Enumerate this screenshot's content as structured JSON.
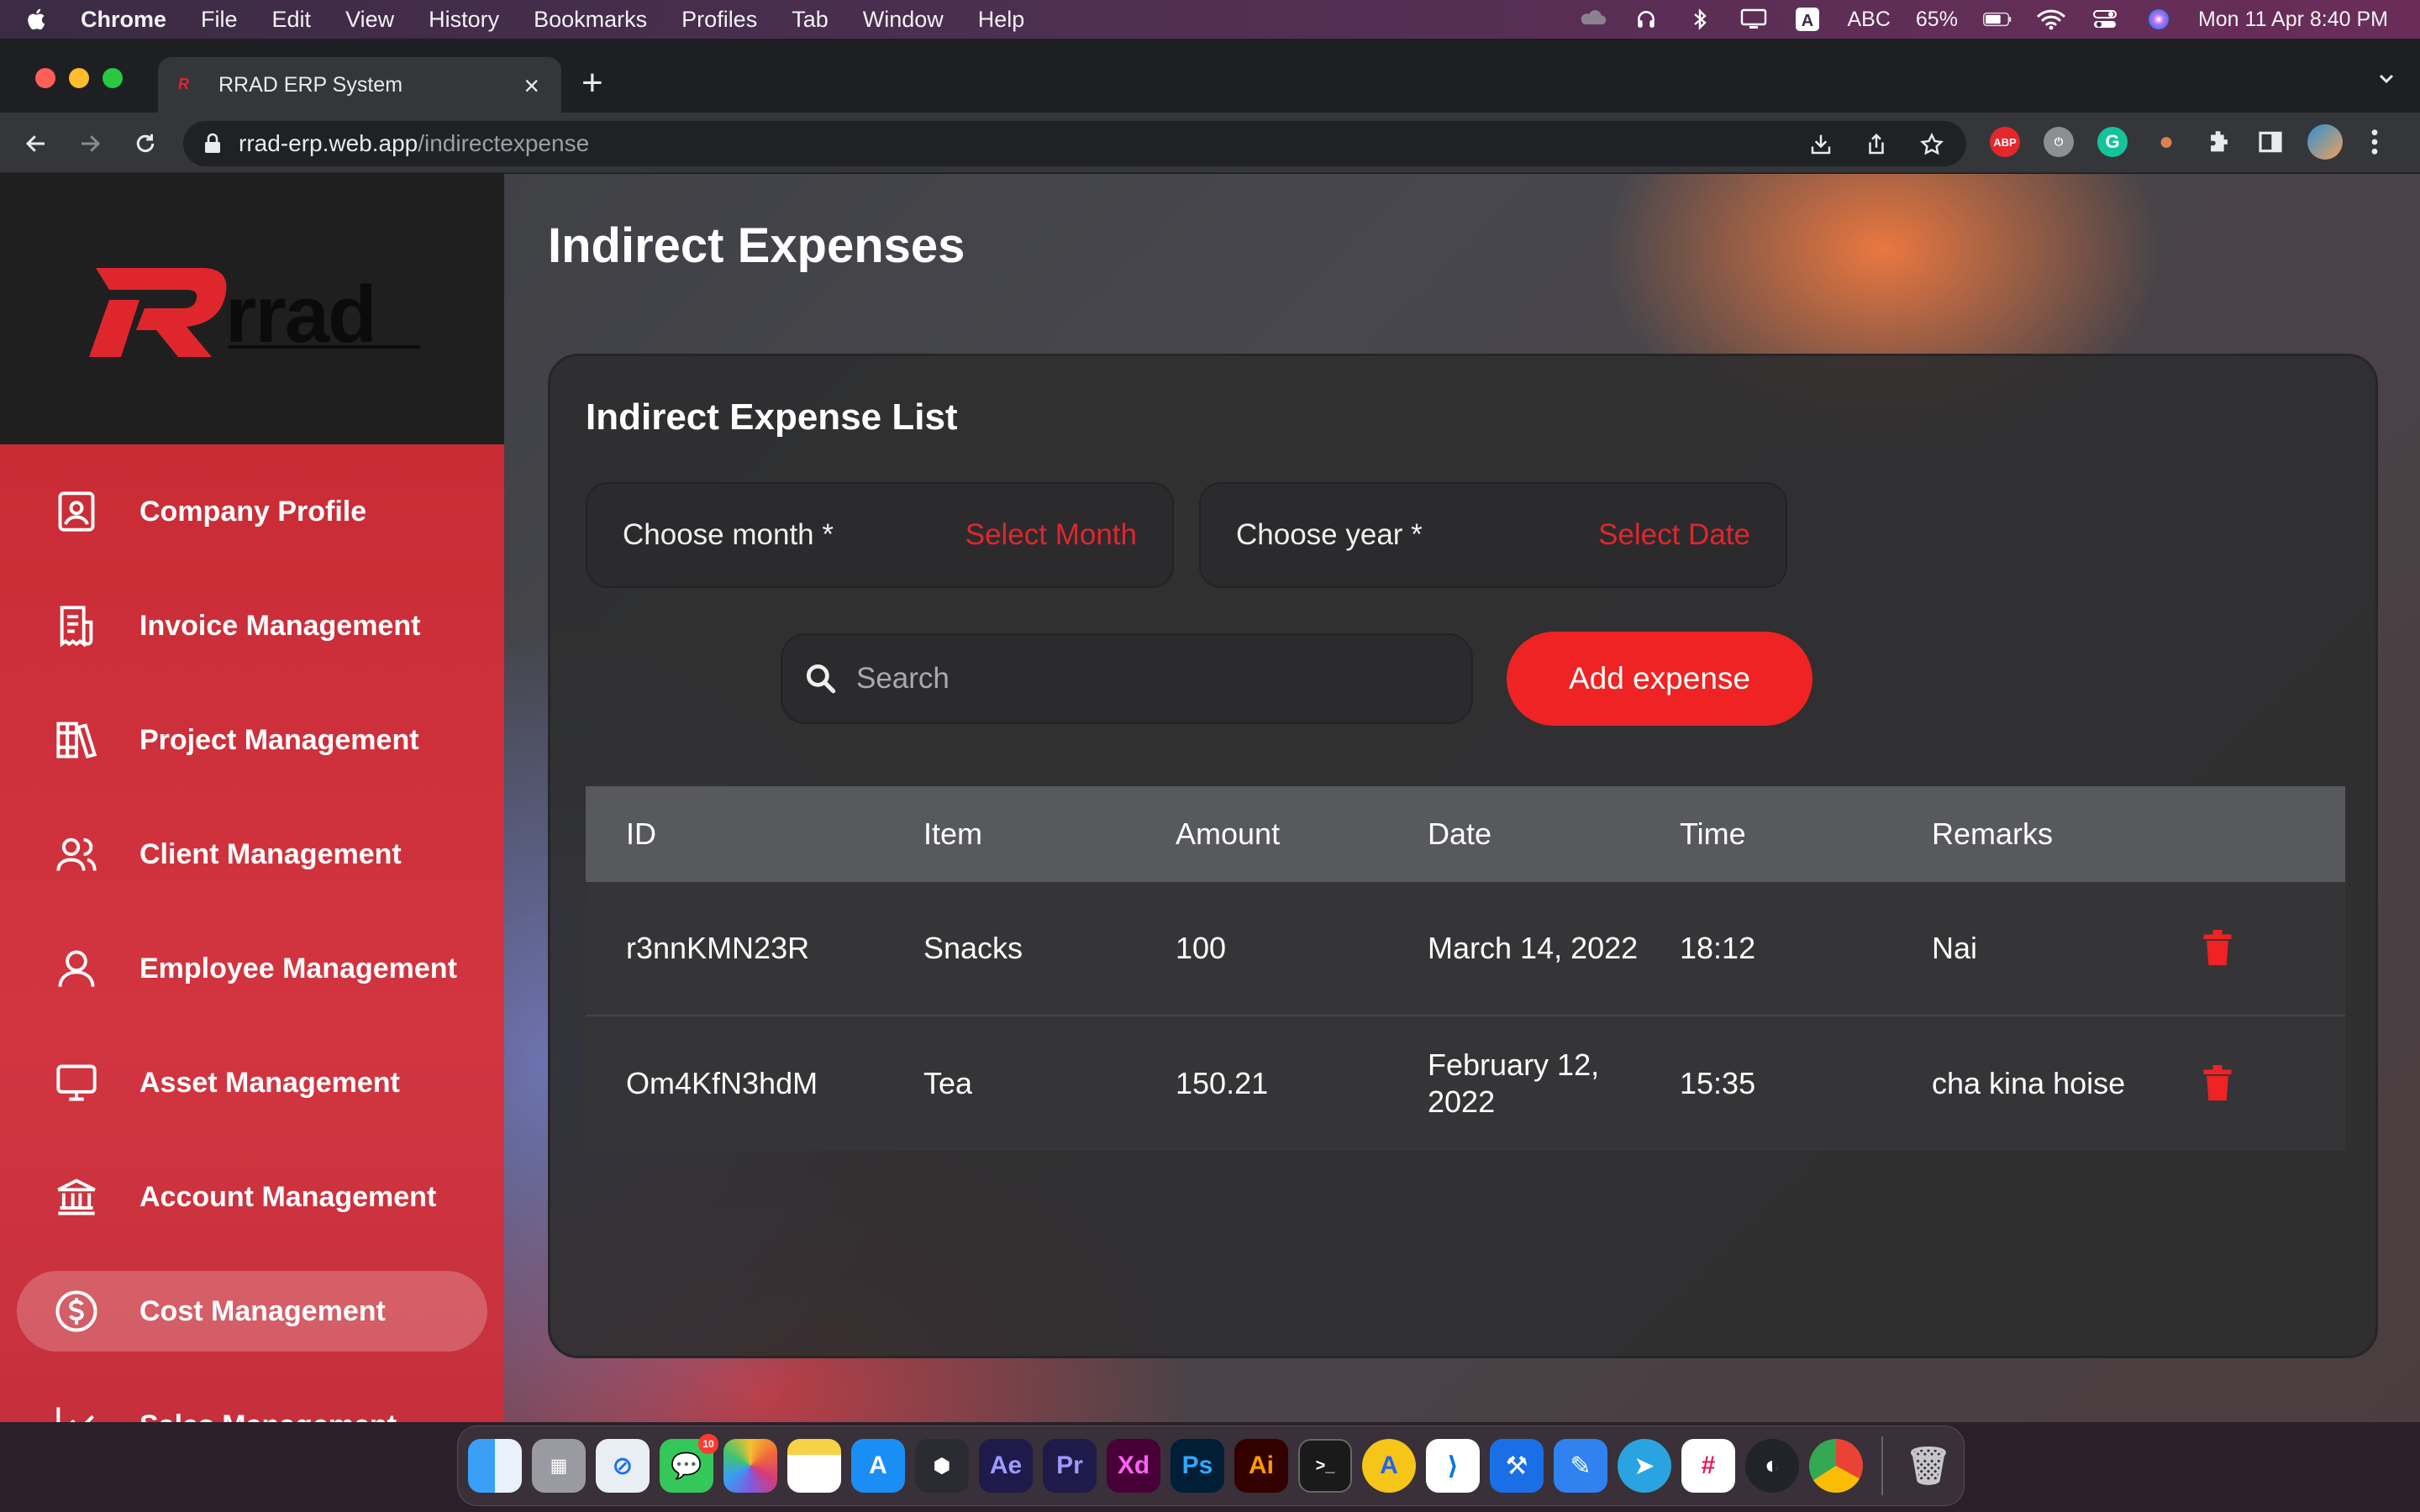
{
  "menubar": {
    "app_name": "Chrome",
    "items": [
      "File",
      "Edit",
      "View",
      "History",
      "Bookmarks",
      "Profiles",
      "Tab",
      "Window",
      "Help"
    ],
    "input_source": "ABC",
    "battery": "65%",
    "datetime": "Mon 11 Apr  8:40 PM"
  },
  "browser": {
    "tab_title": "RRAD ERP System",
    "url_host": "rrad-erp.web.app",
    "url_path": "/indirectexpense",
    "extension_abp": "ABP"
  },
  "sidebar": {
    "items": [
      {
        "label": "Company Profile",
        "icon": "user-card-icon"
      },
      {
        "label": "Invoice Management",
        "icon": "invoice-icon"
      },
      {
        "label": "Project Management",
        "icon": "books-icon"
      },
      {
        "label": "Client Management",
        "icon": "group-icon"
      },
      {
        "label": "Employee Management",
        "icon": "person-icon"
      },
      {
        "label": "Asset Management",
        "icon": "monitor-icon"
      },
      {
        "label": "Account Management",
        "icon": "bank-icon"
      },
      {
        "label": "Cost Management",
        "icon": "dollar-circle-icon",
        "active": true
      },
      {
        "label": "Sales Management",
        "icon": "chart-line-icon"
      }
    ]
  },
  "main": {
    "title": "Indirect Expenses",
    "card_title": "Indirect Expense List",
    "month_label": "Choose month *",
    "month_value": "Select Month",
    "year_label": "Choose year *",
    "year_value": "Select Date",
    "search_placeholder": "Search",
    "add_button": "Add expense",
    "table": {
      "headers": [
        "ID",
        "Item",
        "Amount",
        "Date",
        "Time",
        "Remarks"
      ],
      "rows": [
        {
          "id": "r3nnKMN23R",
          "item": "Snacks",
          "amount": "100",
          "date": "March 14, 2022",
          "time": "18:12",
          "remarks": "Nai"
        },
        {
          "id": "Om4KfN3hdM",
          "item": "Tea",
          "amount": "150.21",
          "date": "February 12, 2022",
          "time": "15:35",
          "remarks": "cha kina hoise"
        }
      ]
    }
  },
  "colors": {
    "accent": "#ef2323",
    "sidebar": "#cf3440",
    "card": "#2d2d2f",
    "table_header": "#58595d"
  },
  "dock": {
    "apps": [
      "Finder",
      "Launchpad",
      "Safari",
      "Messages",
      "Photos",
      "Notes",
      "App Store",
      "DaVinci Resolve",
      "Ae",
      "Pr",
      "Xd",
      "Ps",
      "Ai",
      "Terminal",
      "Arc",
      "VS Code",
      "Xcode",
      "Xcode Instruments",
      "Telegram",
      "Slack",
      "OBS",
      "Chrome",
      "Trash"
    ],
    "messages_badge": "10"
  }
}
